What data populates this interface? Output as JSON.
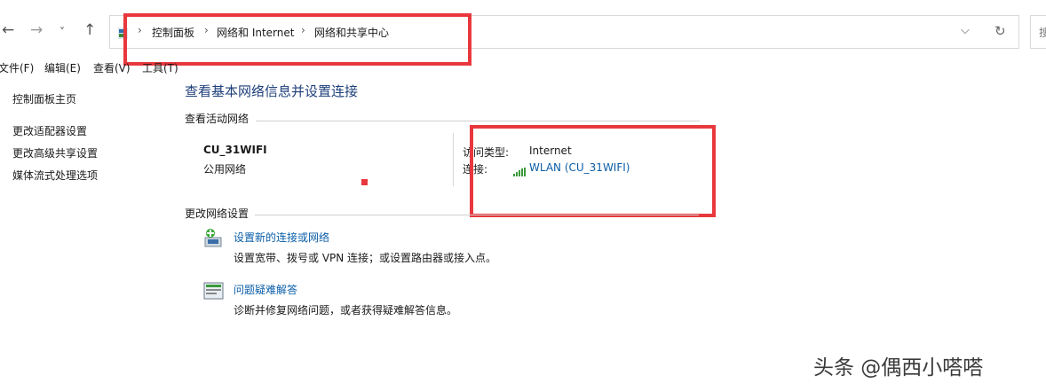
{
  "toolbar": {
    "back_glyph": "←",
    "forward_glyph": "→",
    "recent_glyph": "˅",
    "up_glyph": "↑",
    "dropdown_glyph": "⌵",
    "refresh_glyph": "↻",
    "search_partial": "搜"
  },
  "breadcrumb": {
    "lead_sep": "›",
    "items": [
      "控制面板",
      "网络和 Internet",
      "网络和共享中心"
    ],
    "sep": "›"
  },
  "menu": {
    "file": "文件(F)",
    "edit": "编辑(E)",
    "view": "查看(V)",
    "tools": "工具(T)"
  },
  "sidebar": {
    "home": "控制面板主页",
    "items": [
      "更改适配器设置",
      "更改高级共享设置",
      "媒体流式处理选项"
    ]
  },
  "main": {
    "title": "查看基本网络信息并设置连接",
    "active_section": "查看活动网络",
    "network_name": "CU_31WIFI",
    "network_type": "公用网络",
    "access_label": "访问类型:",
    "access_value": "Internet",
    "conn_label": "连接:",
    "conn_value": "WLAN (CU_31WIFI)",
    "change_section": "更改网络设置",
    "tasks": [
      {
        "title": "设置新的连接或网络",
        "desc": "设置宽带、拨号或 VPN 连接；或设置路由器或接入点。"
      },
      {
        "title": "问题疑难解答",
        "desc": "诊断并修复网络问题，或者获得疑难解答信息。"
      }
    ]
  },
  "watermark": "头条 @偶西小嗒嗒",
  "colors": {
    "annotation_red": "#e8383d",
    "link_blue": "#0b5ea8"
  }
}
